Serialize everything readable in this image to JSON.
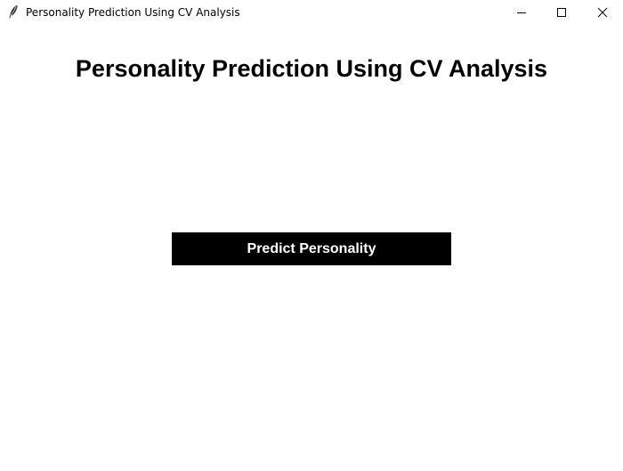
{
  "window": {
    "title": "Personality Prediction Using CV Analysis",
    "app_icon": "feather-icon",
    "controls": {
      "minimize_icon": "minimize-icon",
      "maximize_icon": "maximize-icon",
      "close_icon": "close-icon"
    }
  },
  "main": {
    "heading": "Personality Prediction Using CV Analysis",
    "predict_button_label": "Predict Personality"
  },
  "colors": {
    "background": "#ffffff",
    "button_background": "#000000",
    "button_text": "#ffffff",
    "heading_text": "#000000"
  }
}
